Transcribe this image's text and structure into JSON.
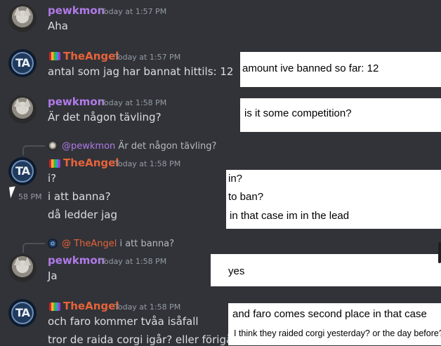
{
  "messages": {
    "m1": {
      "author": "pewkmon",
      "time": "Today at 1:57 PM",
      "lines": [
        "Aha"
      ]
    },
    "m2": {
      "author": "TheAngel",
      "time": "Today at 1:57 PM",
      "lines": [
        "antal som jag har bannat hittils: 12"
      ]
    },
    "m3": {
      "author": "pewkmon",
      "time": "Today at 1:58 PM",
      "lines": [
        "Är det någon tävling?"
      ]
    },
    "m4": {
      "reply_author": "@pewkmon",
      "reply_text": "Är det någon tävling?",
      "author": "TheAngel",
      "time": "Today at 1:58 PM",
      "lines": [
        "i?",
        "i att banna?",
        "då ledder jag"
      ],
      "hover_time": "58 PM"
    },
    "m5": {
      "reply_author": "@ TheAngel",
      "reply_text": "i att banna?",
      "author": "pewkmon",
      "time": "Today at 1:58 PM",
      "lines": [
        "Ja"
      ]
    },
    "m6": {
      "author": "TheAngel",
      "time": "Today at 1:58 PM",
      "lines": [
        "och faro kommer tvåa isåfall",
        "tror de raida corgi igår? eller förigår?"
      ]
    }
  },
  "translations": {
    "t1": "amount ive banned so far: 12",
    "t2": "is it some competition?",
    "t3a": "in?",
    "t3b": "to ban?",
    "t3c": "in that case im in the lead",
    "t4": "yes",
    "t5a": "and faro comes second place in that case",
    "t5b": "I think they raided corgi yesterday? or the day before?"
  },
  "avatars": {
    "pewkmon": "cat-avatar",
    "TheAngel": "ta-logo-avatar"
  }
}
